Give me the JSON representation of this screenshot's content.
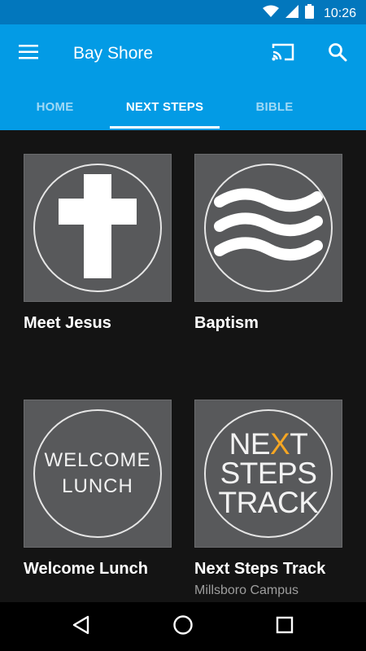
{
  "status_bar": {
    "time": "10:26"
  },
  "app_bar": {
    "title": "Bay Shore"
  },
  "tabs": [
    {
      "label": "HOME",
      "active": false
    },
    {
      "label": "NEXT STEPS",
      "active": true
    },
    {
      "label": "BIBLE",
      "active": false
    }
  ],
  "cards": [
    {
      "title": "Meet Jesus",
      "subtitle": "",
      "icon": "cross-icon"
    },
    {
      "title": "Baptism",
      "subtitle": "",
      "icon": "waves-icon"
    },
    {
      "title": "Welcome Lunch",
      "subtitle": "",
      "logo_lines": [
        "WELCOME",
        "LUNCH"
      ]
    },
    {
      "title": "Next Steps Track",
      "subtitle": "Millsboro Campus",
      "logo_lines": [
        "NE",
        "X",
        "T",
        "STEPS",
        "TRACK"
      ]
    }
  ],
  "colors": {
    "accent": "#039be5",
    "status": "#0277bd",
    "tile": "#58595b",
    "highlight": "#f5a623"
  }
}
